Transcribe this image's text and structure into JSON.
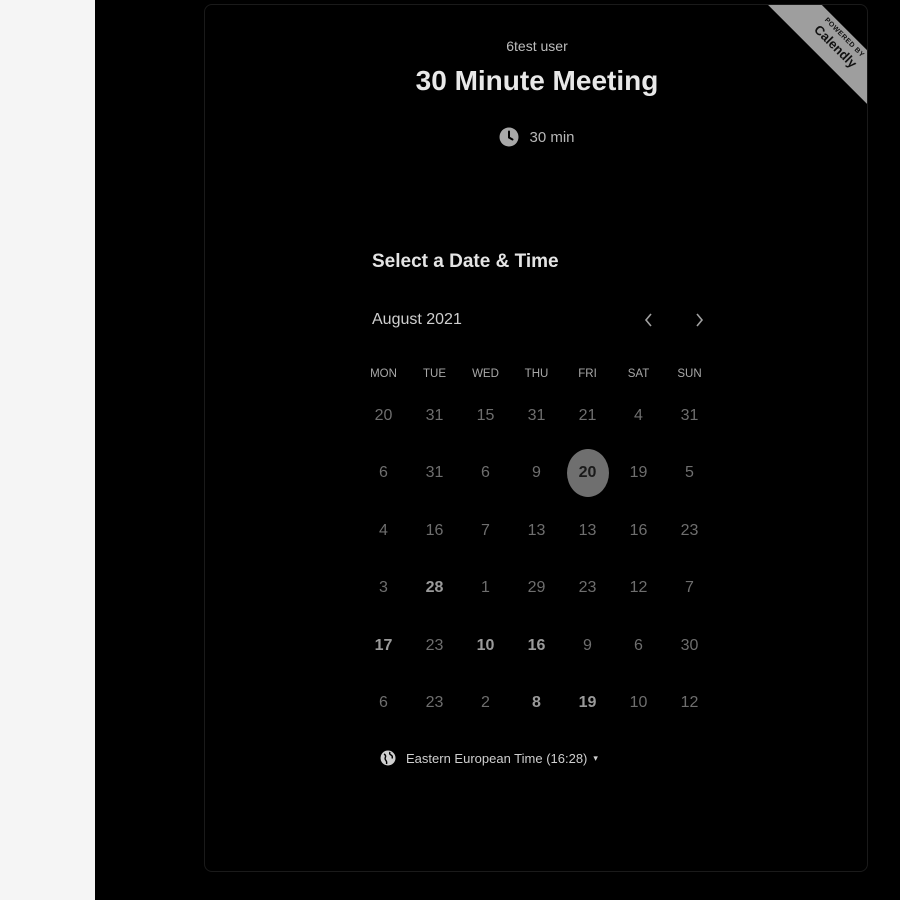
{
  "host": {
    "name": "6test user"
  },
  "event": {
    "title": "30 Minute Meeting",
    "duration": "30 min",
    "duration_icon": "clock-icon"
  },
  "ribbon": {
    "small_text": "POWERED BY",
    "brand": "Calendly"
  },
  "calendar": {
    "heading": "Select a Date & Time",
    "month_label": "August 2021",
    "prev_icon": "chevron-left-icon",
    "next_icon": "chevron-right-icon",
    "weekdays": [
      "MON",
      "TUE",
      "WED",
      "THU",
      "FRI",
      "SAT",
      "SUN"
    ],
    "weeks": [
      [
        {
          "label": "20",
          "bold": false,
          "selected": false
        },
        {
          "label": "31",
          "bold": false,
          "selected": false
        },
        {
          "label": "15",
          "bold": false,
          "selected": false
        },
        {
          "label": "31",
          "bold": false,
          "selected": false
        },
        {
          "label": "21",
          "bold": false,
          "selected": false
        },
        {
          "label": "4",
          "bold": false,
          "selected": false
        },
        {
          "label": "31",
          "bold": false,
          "selected": false
        }
      ],
      [
        {
          "label": "6",
          "bold": false,
          "selected": false
        },
        {
          "label": "31",
          "bold": false,
          "selected": false
        },
        {
          "label": "6",
          "bold": false,
          "selected": false
        },
        {
          "label": "9",
          "bold": false,
          "selected": false
        },
        {
          "label": "20",
          "bold": true,
          "selected": true
        },
        {
          "label": "19",
          "bold": false,
          "selected": false
        },
        {
          "label": "5",
          "bold": false,
          "selected": false
        }
      ],
      [
        {
          "label": "4",
          "bold": false,
          "selected": false
        },
        {
          "label": "16",
          "bold": false,
          "selected": false
        },
        {
          "label": "7",
          "bold": false,
          "selected": false
        },
        {
          "label": "13",
          "bold": false,
          "selected": false
        },
        {
          "label": "13",
          "bold": false,
          "selected": false
        },
        {
          "label": "16",
          "bold": false,
          "selected": false
        },
        {
          "label": "23",
          "bold": false,
          "selected": false
        }
      ],
      [
        {
          "label": "3",
          "bold": false,
          "selected": false
        },
        {
          "label": "28",
          "bold": true,
          "selected": false
        },
        {
          "label": "1",
          "bold": false,
          "selected": false
        },
        {
          "label": "29",
          "bold": false,
          "selected": false
        },
        {
          "label": "23",
          "bold": false,
          "selected": false
        },
        {
          "label": "12",
          "bold": false,
          "selected": false
        },
        {
          "label": "7",
          "bold": false,
          "selected": false
        }
      ],
      [
        {
          "label": "17",
          "bold": true,
          "selected": false
        },
        {
          "label": "23",
          "bold": false,
          "selected": false
        },
        {
          "label": "10",
          "bold": true,
          "selected": false
        },
        {
          "label": "16",
          "bold": true,
          "selected": false
        },
        {
          "label": "9",
          "bold": false,
          "selected": false
        },
        {
          "label": "6",
          "bold": false,
          "selected": false
        },
        {
          "label": "30",
          "bold": false,
          "selected": false
        }
      ],
      [
        {
          "label": "6",
          "bold": false,
          "selected": false
        },
        {
          "label": "23",
          "bold": false,
          "selected": false
        },
        {
          "label": "2",
          "bold": false,
          "selected": false
        },
        {
          "label": "8",
          "bold": true,
          "selected": false
        },
        {
          "label": "19",
          "bold": true,
          "selected": false
        },
        {
          "label": "10",
          "bold": false,
          "selected": false
        },
        {
          "label": "12",
          "bold": false,
          "selected": false
        }
      ]
    ]
  },
  "timezone": {
    "label": "Eastern European Time (16:28)",
    "icon": "globe-icon",
    "caret": "▾"
  },
  "colors": {
    "background": "#000000",
    "left_panel": "#f5f5f5",
    "selected_day": "#6f6f6f",
    "ribbon": "#9e9e9e"
  }
}
